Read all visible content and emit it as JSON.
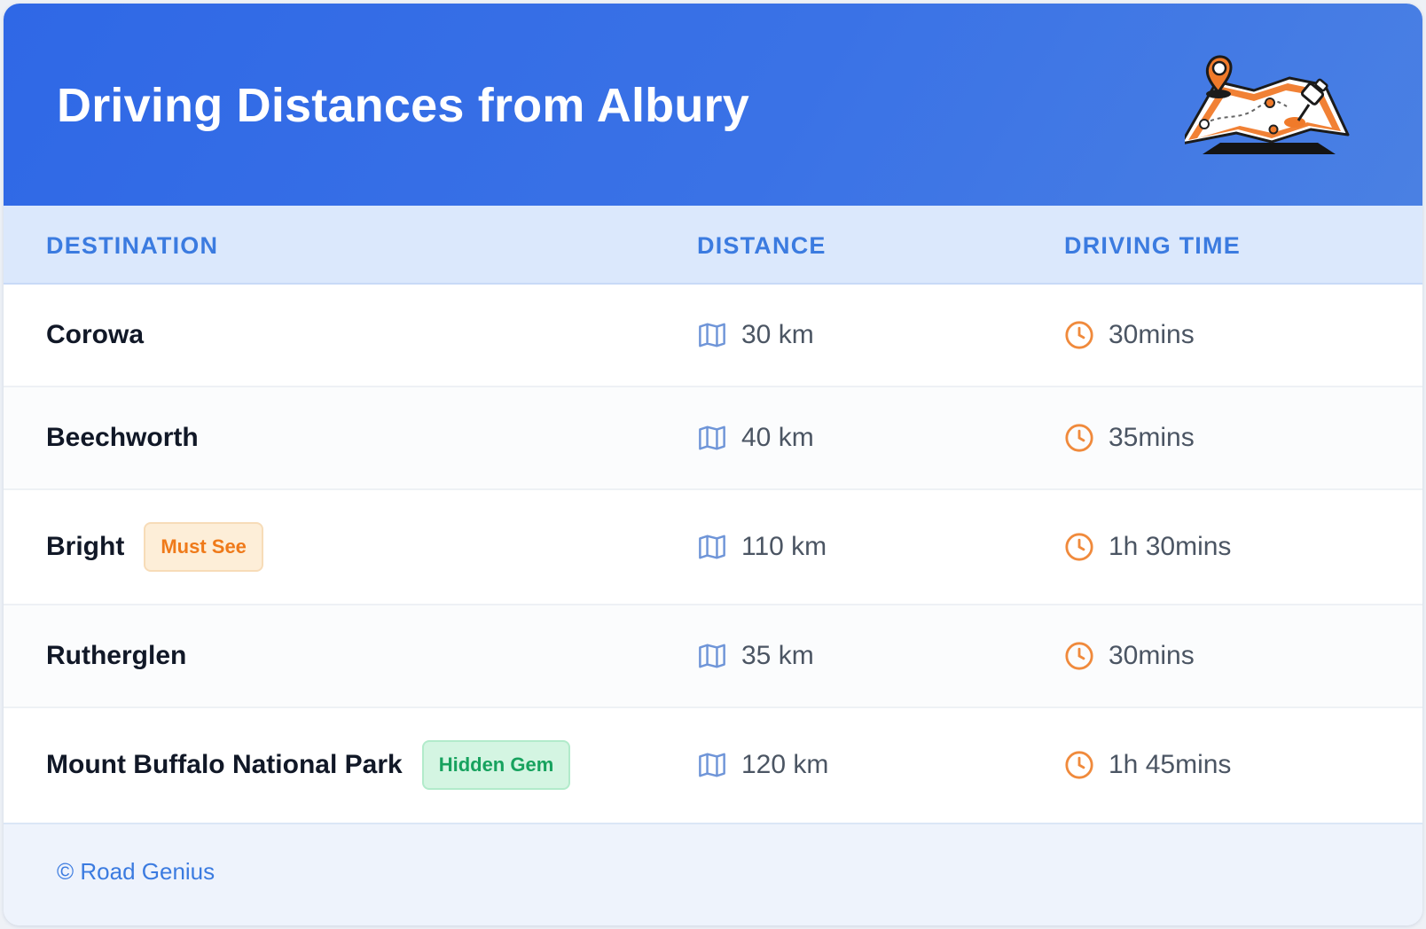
{
  "title": "Driving Distances from Albury",
  "columns": {
    "destination": "DESTINATION",
    "distance": "DISTANCE",
    "driving_time": "DRIVING TIME"
  },
  "rows": [
    {
      "destination": "Corowa",
      "badge": "",
      "distance": "30 km",
      "time": "30mins"
    },
    {
      "destination": "Beechworth",
      "badge": "",
      "distance": "40 km",
      "time": "35mins"
    },
    {
      "destination": "Bright",
      "badge": "Must See",
      "distance": "110 km",
      "time": "1h 30mins"
    },
    {
      "destination": "Rutherglen",
      "badge": "",
      "distance": "35 km",
      "time": "30mins"
    },
    {
      "destination": "Mount Buffalo National Park",
      "badge": "Hidden Gem",
      "distance": "120 km",
      "time": "1h 45mins"
    }
  ],
  "footer": "© Road Genius",
  "icons": {
    "distance": "map-icon",
    "time": "clock-icon",
    "header": "map-with-pins-illustration"
  },
  "colors": {
    "header_blue": "#2f68e6",
    "accent_blue": "#3b7be0",
    "orange": "#ef7a1a",
    "green": "#17a25e"
  }
}
